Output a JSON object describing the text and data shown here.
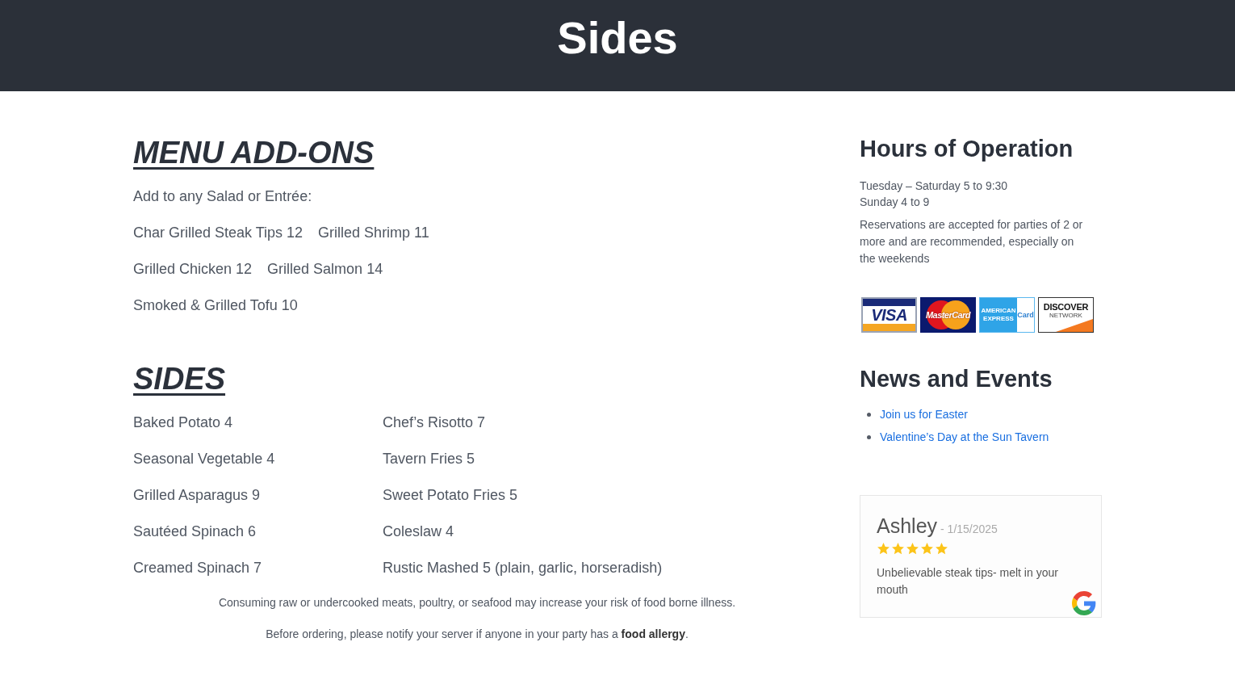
{
  "header": {
    "title": "Sides"
  },
  "addons": {
    "heading": "MENU ADD-ONS",
    "intro": "Add to any Salad or Entrée:",
    "rows": [
      {
        "items": [
          "Char Grilled Steak Tips 12",
          "Grilled Shrimp 11"
        ]
      },
      {
        "items": [
          "Grilled Chicken 12",
          "Grilled Salmon 14"
        ]
      },
      {
        "items": [
          "Smoked & Grilled Tofu 10"
        ]
      }
    ]
  },
  "sides": {
    "heading": "SIDES",
    "rows": [
      {
        "left": "Baked Potato 4",
        "right": "Chef’s Risotto 7"
      },
      {
        "left": "Seasonal Vegetable 4",
        "right": "Tavern Fries 5"
      },
      {
        "left": "Grilled Asparagus 9",
        "right": "Sweet Potato Fries 5"
      },
      {
        "left": "Sautéed Spinach 6",
        "right": "Coleslaw 4"
      },
      {
        "left": "Creamed Spinach 7",
        "right": "Rustic Mashed 5 (plain, garlic, horseradish)"
      }
    ]
  },
  "notices": [
    "Consuming raw or undercooked meats, poultry, or seafood may increase your risk of food borne illness.",
    "Before ordering, please notify your server if anyone in your party has a **food allergy**."
  ],
  "sidebar": {
    "hours": {
      "heading": "Hours of Operation",
      "lines": [
        "Tuesday – Saturday 5 to 9:30",
        "Sunday 4 to 9"
      ],
      "note": "Reservations are accepted for parties of 2 or more and are recommended, especially on the weekends"
    },
    "payment_cards": [
      {
        "kind": "visa",
        "label": "VISA"
      },
      {
        "kind": "mastercard",
        "label": "MasterCard"
      },
      {
        "kind": "amex",
        "label": "AMERICAN EXPRESS",
        "badge": "Card"
      },
      {
        "kind": "discover",
        "label": "DISCOVER",
        "sublabel": "NETWORK"
      }
    ],
    "news": {
      "heading": "News and Events",
      "links": [
        "Join us for Easter",
        "Valentine’s Day at the Sun Tavern"
      ]
    },
    "review": {
      "author": "Ashley",
      "date": "- 1/15/2025",
      "stars": 5,
      "text": "Unbelievable steak tips- melt in your mouth"
    }
  }
}
